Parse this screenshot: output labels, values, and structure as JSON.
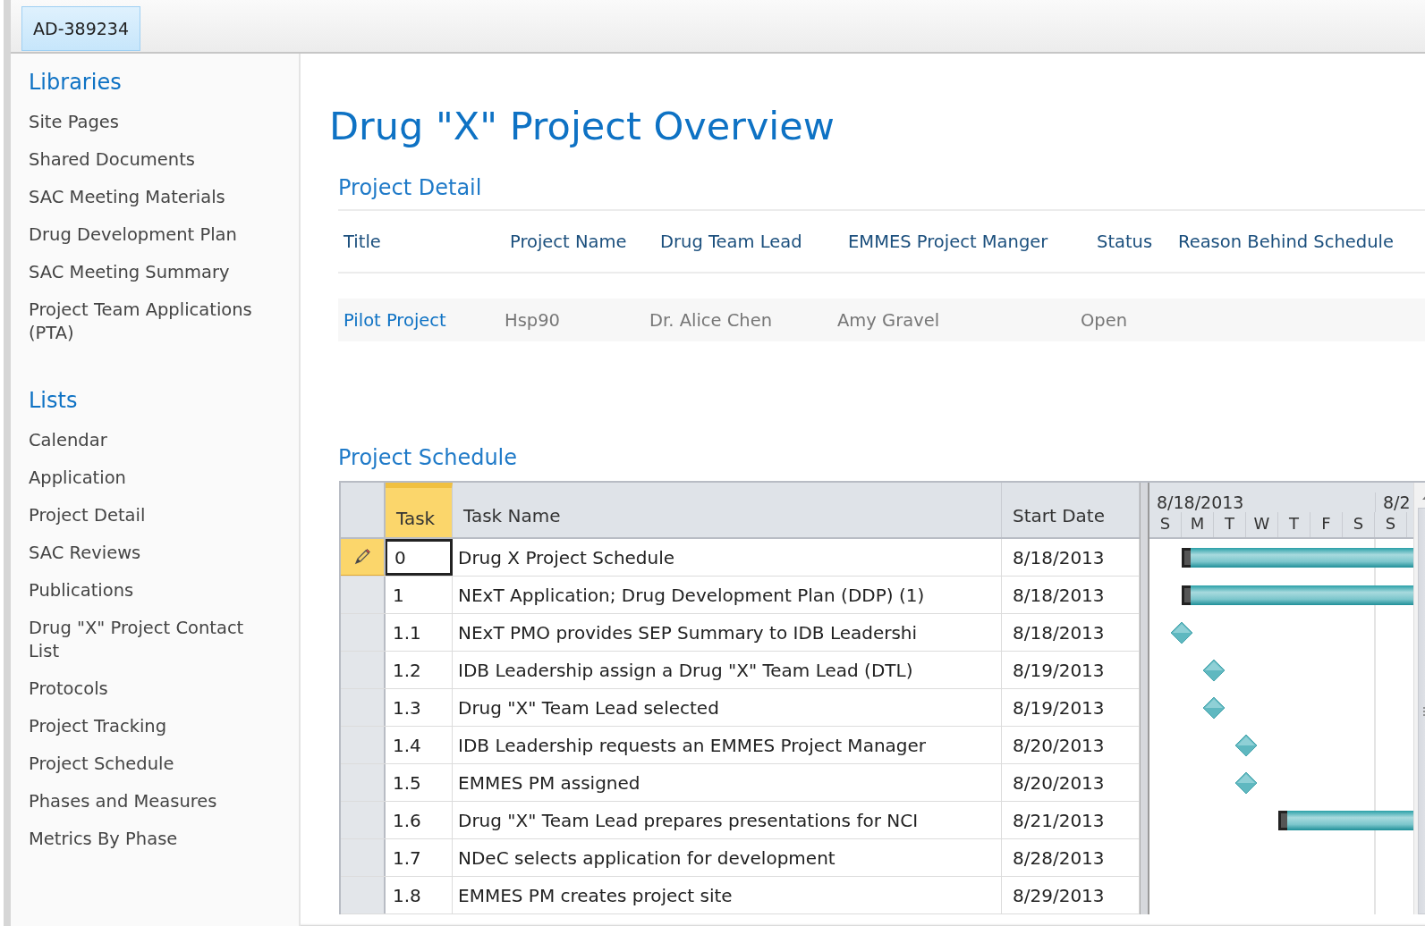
{
  "top_bar": {
    "tab": {
      "label": "AD-389234",
      "selected": true
    }
  },
  "sidebar": {
    "sections": [
      {
        "heading": "Libraries",
        "items": [
          "Site Pages",
          "Shared Documents",
          "SAC Meeting Materials",
          "Drug Development Plan",
          "SAC Meeting Summary",
          "Project Team Applications (PTA)"
        ]
      },
      {
        "heading": "Lists",
        "items": [
          "Calendar",
          "Application",
          "Project Detail",
          "SAC Reviews",
          "Publications",
          "Drug \"X\" Project Contact List",
          "Protocols",
          "Project Tracking",
          "Project Schedule",
          "Phases and Measures",
          "Metrics By Phase"
        ]
      }
    ]
  },
  "page_title": "Drug \"X\" Project Overview",
  "project_detail": {
    "heading": "Project Detail",
    "columns": [
      "Title",
      "Project Name",
      "Drug Team Lead",
      "EMMES Project Manger",
      "Status",
      "Reason Behind Schedule"
    ],
    "rows": [
      [
        "Pilot Project",
        "Hsp90",
        "Dr. Alice Chen",
        "Amy Gravel",
        "Open",
        ""
      ]
    ]
  },
  "project_schedule": {
    "heading": "Project Schedule",
    "columns": [
      {
        "label": "Task",
        "selected": true
      },
      {
        "label": "Task Name",
        "selected": false
      },
      {
        "label": "Start Date",
        "selected": false
      }
    ],
    "gantt": {
      "weeks": [
        "8/18/2013",
        "8/2"
      ],
      "days": [
        "S",
        "M",
        "T",
        "W",
        "T",
        "F",
        "S",
        "S"
      ]
    },
    "rows": [
      {
        "task": "0",
        "name": "Drug X Project Schedule",
        "start": "8/18/2013",
        "kind": "bar",
        "selected": true
      },
      {
        "task": "1",
        "name": "NExT Application; Drug Development Plan (DDP) (1)",
        "start": "8/18/2013",
        "kind": "bar",
        "selected": false
      },
      {
        "task": "1.1",
        "name": "NExT PMO provides SEP Summary to IDB Leadershi",
        "start": "8/18/2013",
        "kind": "milestone",
        "selected": false
      },
      {
        "task": "1.2",
        "name": "IDB Leadership assign a Drug \"X\" Team Lead (DTL)",
        "start": "8/19/2013",
        "kind": "milestone",
        "selected": false
      },
      {
        "task": "1.3",
        "name": "Drug \"X\" Team Lead selected",
        "start": "8/19/2013",
        "kind": "milestone",
        "selected": false
      },
      {
        "task": "1.4",
        "name": "IDB Leadership requests an EMMES Project Manager",
        "start": "8/20/2013",
        "kind": "milestone",
        "selected": false
      },
      {
        "task": "1.5",
        "name": "EMMES PM assigned",
        "start": "8/20/2013",
        "kind": "milestone",
        "selected": false
      },
      {
        "task": "1.6",
        "name": "Drug \"X\" Team Lead prepares presentations for NCI",
        "start": "8/21/2013",
        "kind": "bar",
        "selected": false
      },
      {
        "task": "1.7",
        "name": "NDeC selects application for development",
        "start": "8/28/2013",
        "kind": "none",
        "selected": false
      },
      {
        "task": "1.8",
        "name": "EMMES PM creates project site",
        "start": "8/29/2013",
        "kind": "none",
        "selected": false
      }
    ]
  }
}
